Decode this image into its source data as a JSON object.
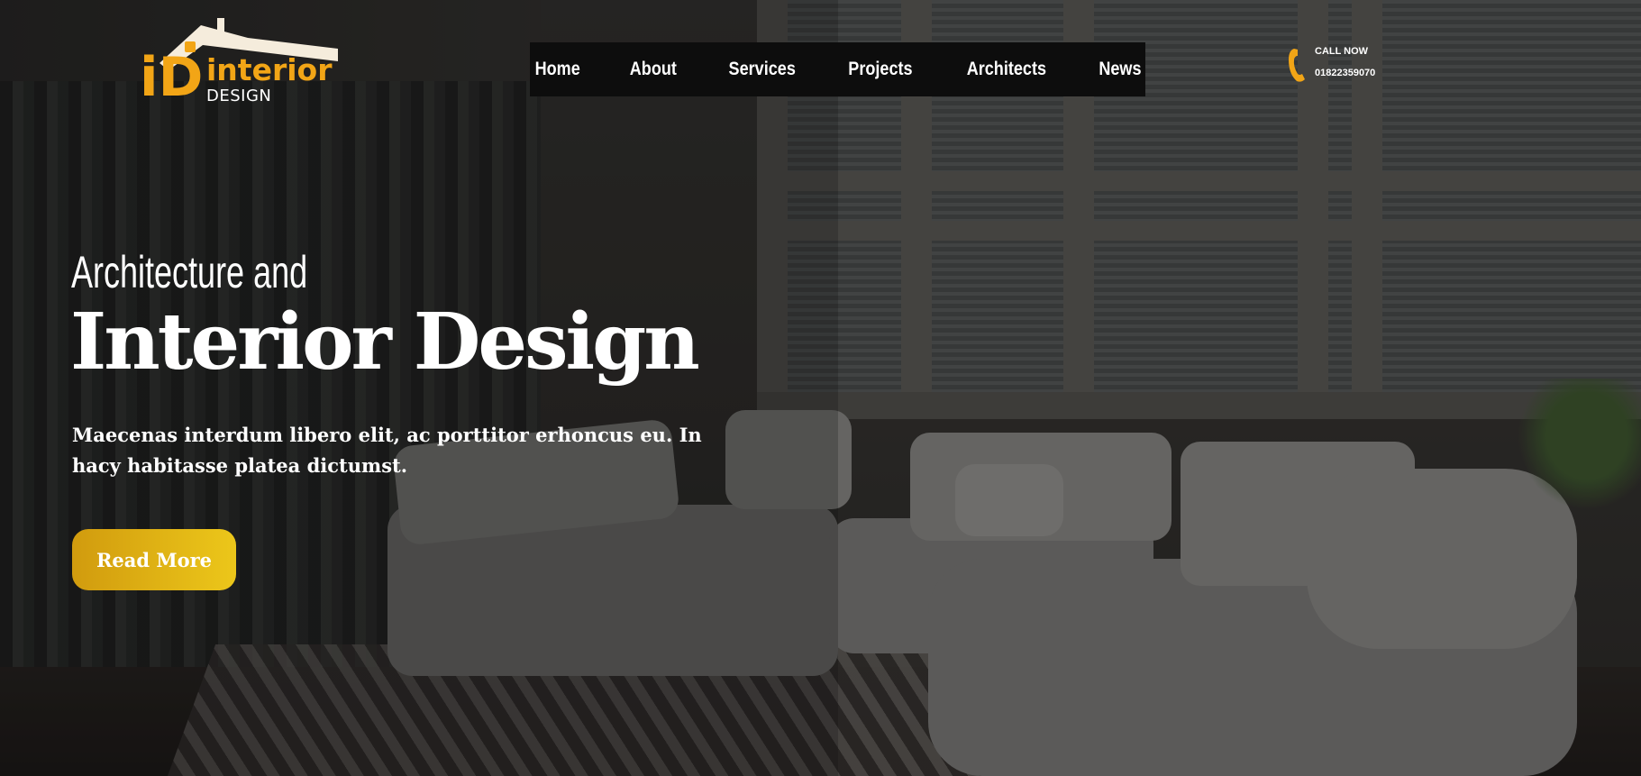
{
  "brand": {
    "logo_mark": "iD",
    "logo_word1": "interior",
    "logo_word2": "DESIGN",
    "accent_color": "#f2a516"
  },
  "nav": {
    "items": [
      {
        "label": "Home"
      },
      {
        "label": "About"
      },
      {
        "label": "Services"
      },
      {
        "label": "Projects"
      },
      {
        "label": "Architects"
      },
      {
        "label": "News"
      }
    ]
  },
  "contact": {
    "label": "CALL NOW",
    "phone": "01822359070",
    "icon": "phone-icon"
  },
  "hero": {
    "kicker": "Architecture and",
    "headline": "Interior Design",
    "lede": "Maecenas interdum libero elit, ac porttitor erhoncus eu. In hacy habitasse platea dictumst.",
    "cta_label": "Read More",
    "cta_color_start": "#d19b0e",
    "cta_color_end": "#ecc71a"
  }
}
